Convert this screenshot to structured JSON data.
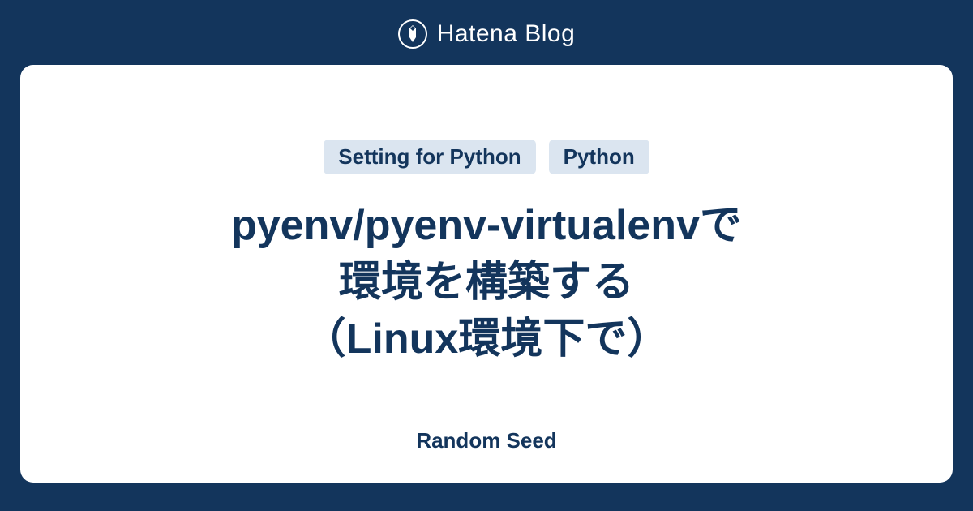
{
  "header": {
    "logo_text": "Hatena Blog"
  },
  "card": {
    "tags": [
      "Setting for Python",
      "Python"
    ],
    "title_line1": "pyenv/pyenv-virtualenvで",
    "title_line2": "環境を構築する",
    "title_line3": "（Linux環境下で）",
    "blog_name": "Random Seed"
  }
}
